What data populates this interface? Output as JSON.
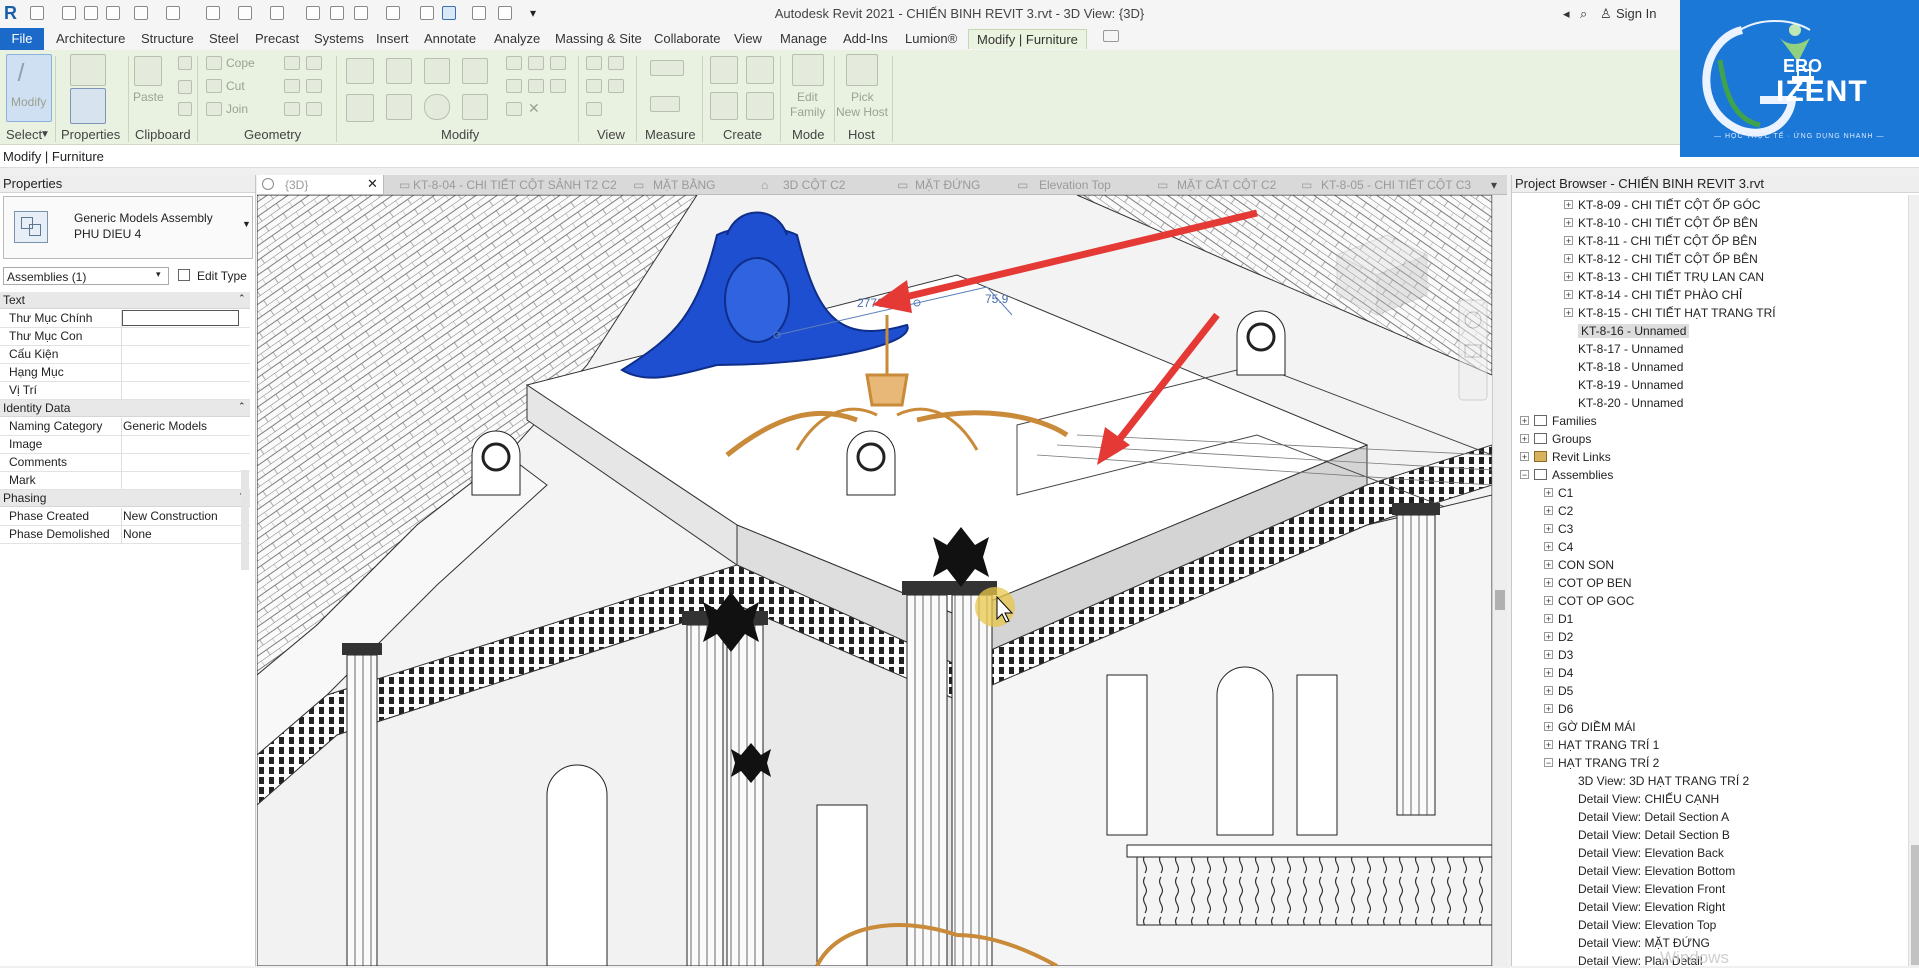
{
  "window": {
    "title": "Autodesk Revit 2021 - CHIẾN BINH REVIT 3.rvt - 3D View: {3D}",
    "sign_in": "Sign In"
  },
  "ribbon_tabs": [
    "Architecture",
    "Structure",
    "Steel",
    "Precast",
    "Systems",
    "Insert",
    "Annotate",
    "Analyze",
    "Massing & Site",
    "Collaborate",
    "View",
    "Manage",
    "Add-Ins",
    "Lumion®"
  ],
  "file_tab": "File",
  "context_tab": "Modify | Furniture",
  "ribbon": {
    "modify": "Modify",
    "paste": "Paste",
    "cope": "Cope",
    "cut": "Cut",
    "join": "Join",
    "edit_family": "Edit\nFamily",
    "edit_family_l1": "Edit",
    "edit_family_l2": "Family",
    "pick_new_host_l1": "Pick",
    "pick_new_host_l2": "New Host",
    "panels": {
      "select": "Select",
      "properties": "Properties",
      "clipboard": "Clipboard",
      "geometry": "Geometry",
      "modify": "Modify",
      "view": "View",
      "measure": "Measure",
      "create": "Create",
      "mode": "Mode",
      "host": "Host"
    }
  },
  "context_bar": "Modify | Furniture",
  "properties": {
    "header": "Properties",
    "type_line1": "Generic Models Assembly",
    "type_line2": "PHU DIEU 4",
    "filter": "Assemblies (1)",
    "edit_type": "Edit Type",
    "groups": [
      {
        "name": "Text",
        "rows": [
          {
            "k": "Thư Mục Chính",
            "v": ""
          },
          {
            "k": "Thư Mục Con",
            "v": ""
          },
          {
            "k": "Cấu Kiện",
            "v": ""
          },
          {
            "k": "Hạng Mục",
            "v": ""
          },
          {
            "k": "Vị Trí",
            "v": ""
          }
        ]
      },
      {
        "name": "Identity Data",
        "rows": [
          {
            "k": "Naming Category",
            "v": "Generic Models"
          },
          {
            "k": "Image",
            "v": ""
          },
          {
            "k": "Comments",
            "v": ""
          },
          {
            "k": "Mark",
            "v": ""
          }
        ]
      },
      {
        "name": "Phasing",
        "rows": [
          {
            "k": "Phase Created",
            "v": "New Construction"
          },
          {
            "k": "Phase Demolished",
            "v": "None"
          }
        ]
      }
    ]
  },
  "view_tabs": [
    "{3D}",
    "KT-8-04 - CHI TIẾT CỘT SẢNH T2 C2",
    "MẶT BẰNG",
    "3D CỘT C2",
    "MẶT ĐỨNG",
    "Elevation Top",
    "MẶT CẮT CỘT C2",
    "KT-8-05 - CHI TIẾT CỘT C3"
  ],
  "viewport": {
    "dim1": "2770.0",
    "dim2": "75.9"
  },
  "browser": {
    "header": "Project Browser - CHIẾN BINH REVIT 3.rvt",
    "sheets": [
      {
        "label": "KT-8-09 - CHI TIẾT CỘT ỐP GÓC",
        "expand": true
      },
      {
        "label": "KT-8-10 - CHI TIẾT CỘT ỐP BÊN",
        "expand": true
      },
      {
        "label": "KT-8-11 - CHI TIẾT CỘT ỐP BÊN",
        "expand": true
      },
      {
        "label": "KT-8-12 - CHI TIẾT CỘT ỐP BÊN",
        "expand": true
      },
      {
        "label": "KT-8-13 - CHI TIẾT TRỤ LAN CAN",
        "expand": true
      },
      {
        "label": "KT-8-14 - CHI TIẾT PHÀO CHỈ",
        "expand": true
      },
      {
        "label": "KT-8-15 - CHI TIẾT HẠT TRANG TRÍ",
        "expand": true
      },
      {
        "label": "KT-8-16 - Unnamed",
        "expand": false
      },
      {
        "label": "KT-8-17 - Unnamed",
        "expand": false
      },
      {
        "label": "KT-8-18 - Unnamed",
        "expand": false
      },
      {
        "label": "KT-8-19 - Unnamed",
        "expand": false
      },
      {
        "label": "KT-8-20 - Unnamed",
        "expand": false
      }
    ],
    "categories": [
      "Families",
      "Groups",
      "Revit Links",
      "Assemblies"
    ],
    "assemblies": [
      "C1",
      "C2",
      "C3",
      "C4",
      "CON SON",
      "COT OP BEN",
      "COT OP GOC",
      "D1",
      "D2",
      "D3",
      "D4",
      "D5",
      "D6",
      "GỜ DIỀM MÁI",
      "HẠT TRANG TRÍ 1",
      "HẠT TRANG TRÍ 2"
    ],
    "hat2_views": [
      "3D View: 3D HẠT TRANG TRÍ 2",
      "Detail View: CHIẾU CẠNH",
      "Detail View: Detail Section A",
      "Detail View: Detail Section B",
      "Detail View: Elevation Back",
      "Detail View: Elevation Bottom",
      "Detail View: Elevation Front",
      "Detail View: Elevation Right",
      "Detail View: Elevation Top",
      "Detail View: MẶT ĐỨNG",
      "Detail View: Plan Detail"
    ],
    "watermark": "Windows"
  },
  "brand": {
    "name_line1": "ERO",
    "name_line2": "IZENT",
    "tagline": "— HỌC THỰC TẾ · ỨNG DỤNG NHANH —",
    "bg": "#1c78d6"
  },
  "colors": {
    "accent": "#1b6ac9",
    "ribbon_bg": "#e9f2e0",
    "selection_blue": "#1f4fd1",
    "highlight_orange": "#c98a3a",
    "arrow_red": "#e53935"
  }
}
